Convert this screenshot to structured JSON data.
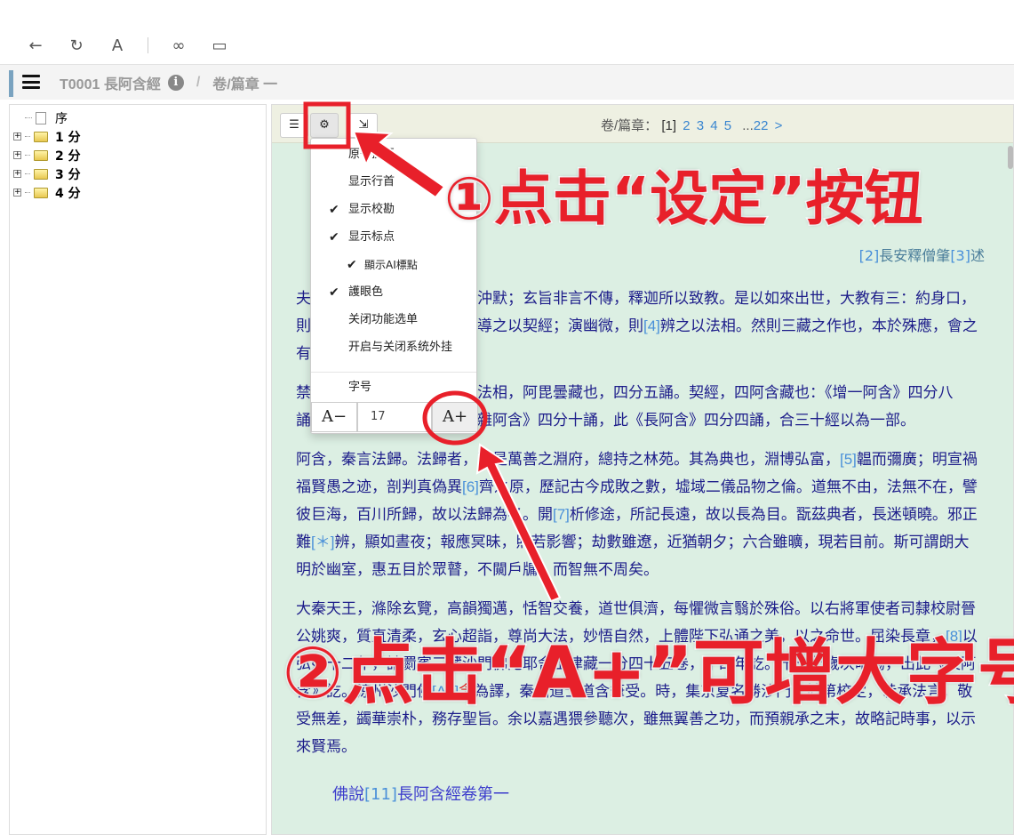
{
  "browser": {
    "icons": [
      "back-icon",
      "refresh-icon",
      "font-icon",
      "link-icon",
      "window-icon"
    ],
    "font_glyph": "A"
  },
  "header": {
    "title": "T0001 長阿含經",
    "separator": "/",
    "chapter": "卷/篇章 一",
    "info": "i"
  },
  "tree": [
    {
      "label": "序"
    },
    {
      "label": "1 分"
    },
    {
      "label": "2 分"
    },
    {
      "label": "3 分"
    },
    {
      "label": "4 分"
    }
  ],
  "toolbar": {
    "pager_label": "卷/篇章：",
    "current": "[1]",
    "pages": [
      "2",
      "3",
      "4",
      "5"
    ],
    "ellipsis": "...",
    "last": "22",
    "next": ">"
  },
  "menu": {
    "items": [
      {
        "label": "原书换行",
        "checked": false
      },
      {
        "label": "显示行首",
        "checked": false
      },
      {
        "label": "显示校勘",
        "checked": true
      },
      {
        "label": "显示标点",
        "checked": true
      },
      {
        "label": "顯示AI標點",
        "checked": true
      },
      {
        "label": "護眼色",
        "checked": true
      },
      {
        "label": "关闭功能选单",
        "checked": false
      },
      {
        "label": "开启与关闭系统外挂",
        "checked": false
      }
    ],
    "font_size_label": "字号",
    "decrease": "A−",
    "value": "17",
    "increase": "A+"
  },
  "content": {
    "author": {
      "n1": "[2]",
      "a": "長安釋僧肇",
      "n2": "[3]",
      "b": "述"
    },
    "p1": {
      "a": "夫宗極絕於稱謂，賢聖以之沖默；玄旨非言不傳，釋迦所以致教。是以如來出世，大教有三：約身口，則防之以禁律；明善惡，則導之以契經；演幽微，則",
      "n": "[4]",
      "b": "辨之以法相。然則三藏之作也，本於殊應，會之有宜。"
    },
    "p2": "禁律，律藏也，四分十誦。法相，阿毘曇藏也，四分五誦。契經，四阿含藏也：《增一阿含》四分八誦，《中阿含》四分五誦，《雜阿含》四分十誦，此《長阿含》四分四誦，合三十經以為一部。",
    "p3": {
      "a": "阿含，秦言法歸。法歸者，蓋是萬善之淵府，總持之林苑。其為典也，淵博弘富，",
      "n5": "[5]",
      "b": "韞而彌廣；明宣禍福賢愚之迹，剖判真偽異",
      "n6": "[6]",
      "c": "齊之原，歷記古今成敗之數，墟域二儀品物之倫。道無不由，法無不在，譬彼巨海，百川所歸，故以法歸為名。開",
      "n7": "[7]",
      "d": "析修途，所記長遠，故以長為目。翫茲典者，長迷頓曉。邪正難",
      "n8": "[＊]",
      "e": "辨，顯如晝夜；報應冥昧，照若影響；劫數雖遼，近猶朝夕；六合雖曠，現若目前。斯可謂朗大明於幽室，惠五目於眾瞽，不闚戶牖，而智無不周矣。"
    },
    "p4": {
      "a": "大秦天王，滌除玄覽，高韻獨邁，恬智交養，道世俱濟，每懼微言翳於殊俗。以右將軍使者司隸校尉晉公姚爽，質直清柔，玄心超詣，尊尚大法，妙悟自然，上體陛下弘通之美，以之命世。屈染長章，",
      "n8": "[8]",
      "b": "以弘始十二年，請罽賓三藏沙門佛陀耶舍出律藏一分四十五卷，十四年訖。十五年歲次昭陽，出此《長阿含》訖。涼州沙門佛",
      "n9": "[A1]",
      "r": "念",
      "c": "為譯，秦國道士道含筆受。時，集京夏名勝沙門，於第校定，恭承法言，敬受無差，蠲華崇朴，務存聖旨。余以嘉遇猥參聽次，雖無翼善之功，而預親承之末，故略記時事，以示來賢焉。"
    },
    "scripture_title": {
      "a": "佛說",
      "n": "[11]",
      "b": "長阿含經卷第一"
    }
  },
  "annotations": {
    "step1": "①点击“设定”按钮",
    "step2": "②点击“A+”可增大字号"
  },
  "colors": {
    "annotation": "#e8202a",
    "text": "#1d1d8a",
    "note": "#4a90d9",
    "eye_bg": "#dcefe3"
  }
}
